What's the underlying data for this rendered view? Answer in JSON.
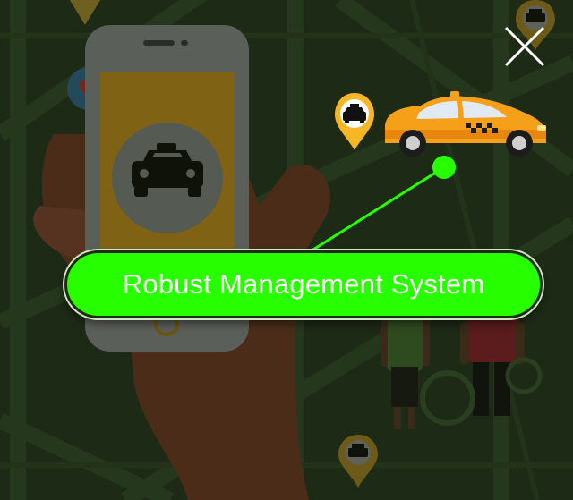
{
  "popup": {
    "feature_label": "Robust Management System",
    "close_icon": "close-icon",
    "accent_color": "#27ff00",
    "taxi_color": "#f6a01a"
  },
  "background": {
    "map_color": "#1d2a16",
    "icons": [
      "map-grid",
      "smartphone-icon",
      "taxi-icon",
      "heart-pin-icon",
      "taxi-pin-icon",
      "person-icon"
    ]
  }
}
